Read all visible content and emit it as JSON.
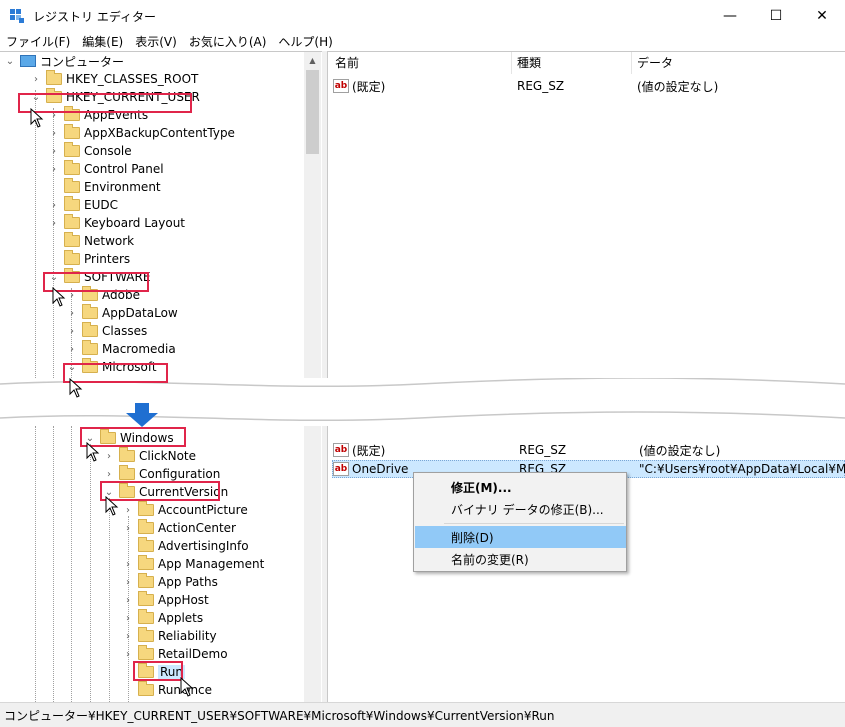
{
  "window": {
    "title": "レジストリ エディター",
    "minimize_glyph": "—",
    "maximize_glyph": "☐",
    "close_glyph": "✕"
  },
  "menu": [
    "ファイル(F)",
    "編集(E)",
    "表示(V)",
    "お気に入り(A)",
    "ヘルプ(H)"
  ],
  "tree_top": [
    {
      "label": "コンピューター",
      "icon": "computer-icon",
      "chev": "⌄"
    },
    {
      "label": "HKEY_CLASSES_ROOT",
      "chev": "›"
    },
    {
      "label": "HKEY_CURRENT_USER",
      "chev": "⌄"
    },
    {
      "label": "AppEvents",
      "chev": "›"
    },
    {
      "label": "AppXBackupContentType",
      "chev": "›"
    },
    {
      "label": "Console",
      "chev": "›"
    },
    {
      "label": "Control Panel",
      "chev": "›"
    },
    {
      "label": "Environment",
      "chev": ""
    },
    {
      "label": "EUDC",
      "chev": "›"
    },
    {
      "label": "Keyboard Layout",
      "chev": "›"
    },
    {
      "label": "Network",
      "chev": ""
    },
    {
      "label": "Printers",
      "chev": ""
    },
    {
      "label": "SOFTWARE",
      "chev": "⌄"
    },
    {
      "label": "Adobe",
      "chev": "›"
    },
    {
      "label": "AppDataLow",
      "chev": "›"
    },
    {
      "label": "Classes",
      "chev": "›"
    },
    {
      "label": "Macromedia",
      "chev": "›"
    },
    {
      "label": "Microsoft",
      "chev": "⌄"
    }
  ],
  "tree_bottom": [
    {
      "label": "Windows",
      "chev": "⌄"
    },
    {
      "label": "ClickNote",
      "chev": "›"
    },
    {
      "label": "Configuration",
      "chev": "›"
    },
    {
      "label": "CurrentVersion",
      "chev": "⌄"
    },
    {
      "label": "AccountPicture",
      "chev": "›"
    },
    {
      "label": "ActionCenter",
      "chev": "›"
    },
    {
      "label": "AdvertisingInfo",
      "chev": ""
    },
    {
      "label": "App Management",
      "chev": "›"
    },
    {
      "label": "App Paths",
      "chev": "›"
    },
    {
      "label": "AppHost",
      "chev": "›"
    },
    {
      "label": "Applets",
      "chev": "›"
    },
    {
      "label": "Reliability",
      "chev": "›"
    },
    {
      "label": "RetailDemo",
      "chev": "›"
    },
    {
      "label": "Run",
      "chev": ""
    },
    {
      "label": "RunOnce",
      "chev": ""
    }
  ],
  "columns": {
    "name": "名前",
    "type": "種類",
    "data": "データ"
  },
  "values_top": [
    {
      "name": "(既定)",
      "type": "REG_SZ",
      "data": "(値の設定なし)"
    }
  ],
  "values_bottom": [
    {
      "name": "(既定)",
      "type": "REG_SZ",
      "data": "(値の設定なし)"
    },
    {
      "name": "OneDrive",
      "type": "REG_SZ",
      "data": "\"C:¥Users¥root¥AppData¥Local¥Micros"
    }
  ],
  "icon_ab": "ab",
  "context_menu": [
    {
      "label": "修正(M)...",
      "bold": true
    },
    {
      "label": "バイナリ データの修正(B)...",
      "bold": false
    },
    {
      "label": "削除(D)",
      "bold": false,
      "hover": true
    },
    {
      "label": "名前の変更(R)",
      "bold": false
    }
  ],
  "status": "コンピューター¥HKEY_CURRENT_USER¥SOFTWARE¥Microsoft¥Windows¥CurrentVersion¥Run",
  "colors": {
    "highlight_box": "#e0254a",
    "selection": "#cce8ff",
    "menu_hover": "#91c9f7",
    "arrow": "#1f6fd1"
  }
}
